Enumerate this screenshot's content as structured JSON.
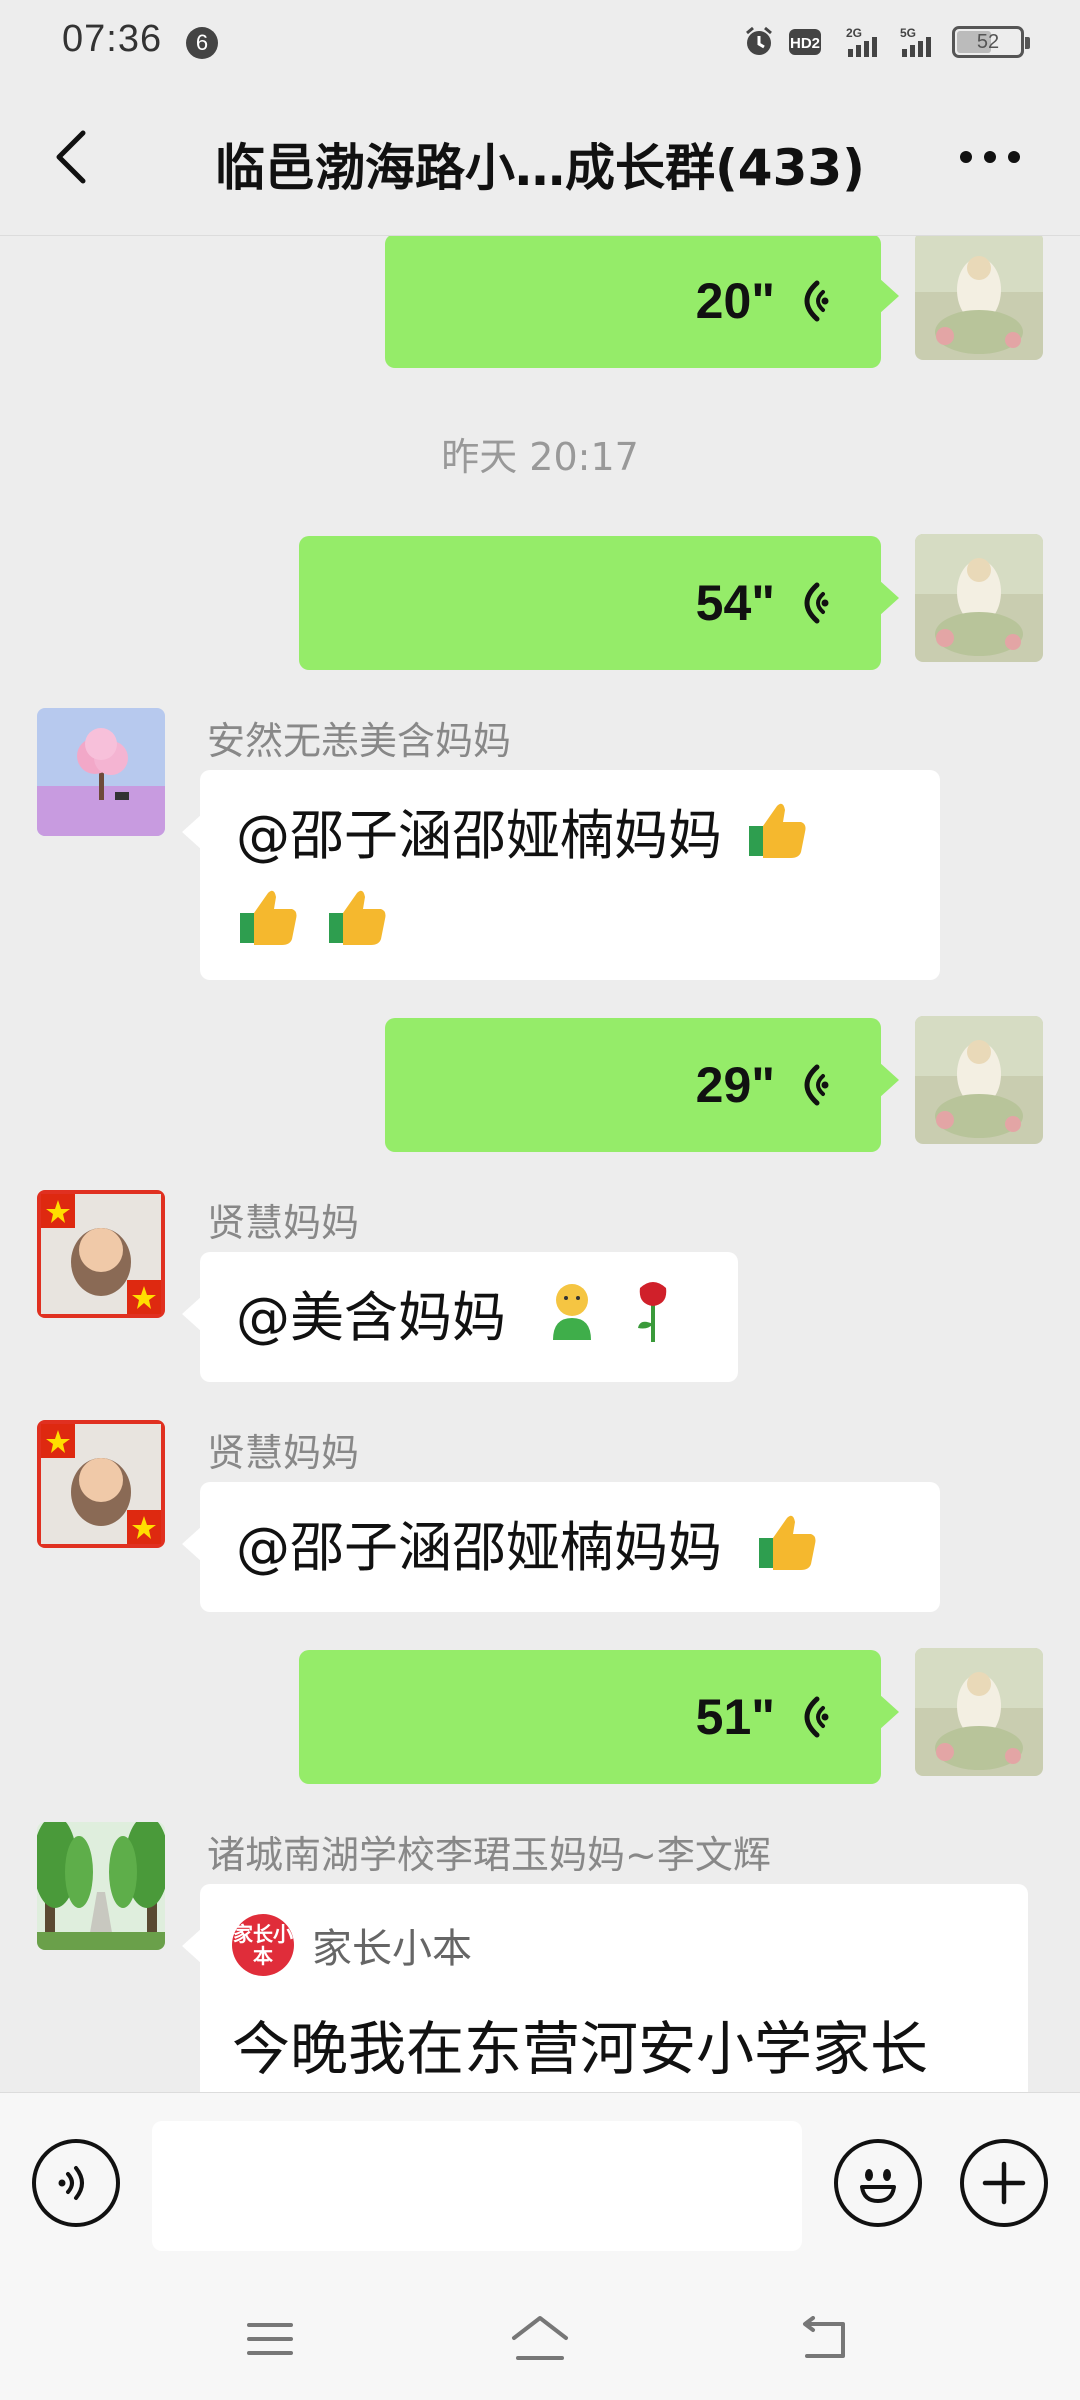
{
  "status_bar": {
    "time": "07:36",
    "notification_count": "6",
    "network_hd": "HD2",
    "network_2g": "2G",
    "network_5g": "5G",
    "battery": "52"
  },
  "header": {
    "title": "临邑渤海路小…成长群(433)"
  },
  "messages": {
    "m1": {
      "duration": "20\""
    },
    "timestamp": "昨天  20:17",
    "m2": {
      "duration": "54\""
    },
    "m3": {
      "sender": "安然无恙美含妈妈",
      "text_line1": "@邵子涵邵娅楠妈妈",
      "text_line2": ""
    },
    "m4": {
      "duration": "29\""
    },
    "m5": {
      "sender": "贤慧妈妈",
      "text": "@美含妈妈"
    },
    "m6": {
      "sender": "贤慧妈妈",
      "text": "@邵子涵邵娅楠妈妈"
    },
    "m7": {
      "duration": "51\""
    },
    "m8": {
      "sender": "诸城南湖学校李珺玉妈妈~李文辉",
      "card_logo": "家长小本",
      "card_source": "家长小本",
      "card_headline": "今晚我在东营河安小学家长"
    }
  },
  "input": {
    "placeholder": ""
  },
  "icons": {
    "back": "chevron-left-icon",
    "more": "more-dots-icon",
    "voice": "voice-icon",
    "emoji": "smiley-icon",
    "plus": "plus-icon",
    "nav_menu": "menu-icon",
    "nav_home": "home-icon",
    "nav_back": "back-icon"
  },
  "colors": {
    "outgoing_bubble": "#95ec69",
    "incoming_bubble": "#ffffff",
    "background": "#ededed"
  }
}
